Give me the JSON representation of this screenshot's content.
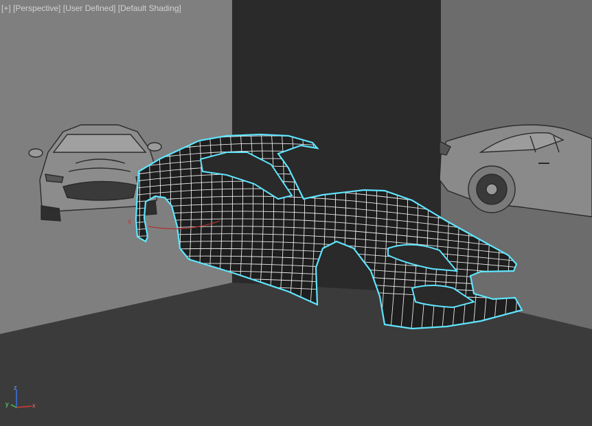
{
  "viewport": {
    "labels": {
      "menu": "[+]",
      "view": "[Perspective]",
      "camera": "[User Defined]",
      "shading": "[Default Shading]"
    },
    "background": "#3a3a3a",
    "mesh_highlight_color": "#5fe6ff",
    "wire_color": "#f0f0f0",
    "mesh_fill": "#1a1a1a"
  },
  "gizmo": {
    "x": "x",
    "y": "y",
    "z": "z"
  },
  "scene": {
    "objects": [
      "left-wall-reference-plane",
      "back-wall-plane",
      "right-wall-reference-plane",
      "floor-plane",
      "front-view-reference-image",
      "side-view-reference-image",
      "car-body-wireframe-mesh"
    ]
  }
}
